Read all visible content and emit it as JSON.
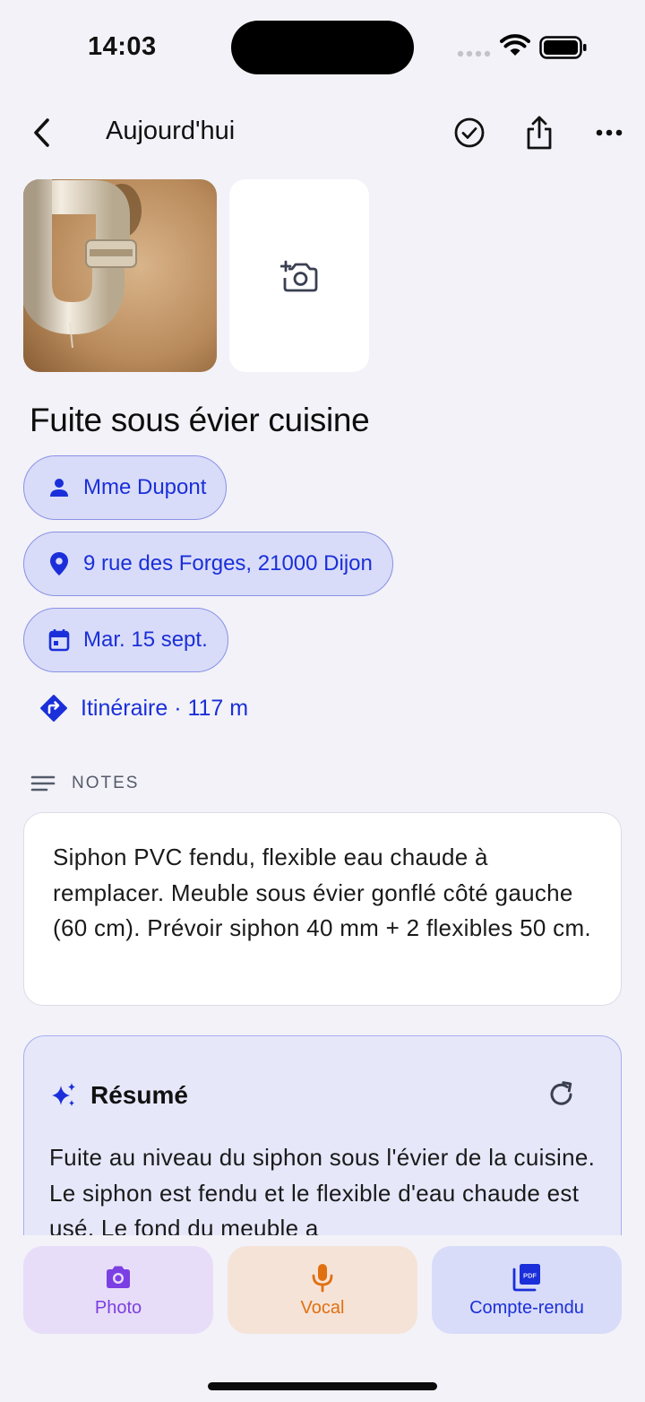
{
  "status": {
    "time": "14:03"
  },
  "nav": {
    "title": "Aujourd'hui"
  },
  "job": {
    "title": "Fuite sous évier cuisine",
    "client": "Mme Dupont",
    "address": "9 rue des Forges, 21000 Dijon",
    "date": "Mar. 15 sept.",
    "route": "Itinéraire · 117 m"
  },
  "notes": {
    "header": "NOTES",
    "text": "Siphon PVC fendu, flexible eau chaude à remplacer. Meuble sous évier gonflé côté gauche (60 cm). Prévoir siphon 40 mm + 2 flexibles 50 cm."
  },
  "summary": {
    "title": "Résumé",
    "text": "Fuite au niveau du siphon sous l'évier de la cuisine. Le siphon est fendu et le flexible d'eau chaude est usé. Le fond du meuble a"
  },
  "actions": {
    "photo": "Photo",
    "vocal": "Vocal",
    "report": "Compte-rendu"
  },
  "colors": {
    "accent": "#1a2fd9",
    "chip_bg": "#d9dcf8",
    "photo_purple": "#7b3fe4",
    "vocal_orange": "#e0700f"
  }
}
